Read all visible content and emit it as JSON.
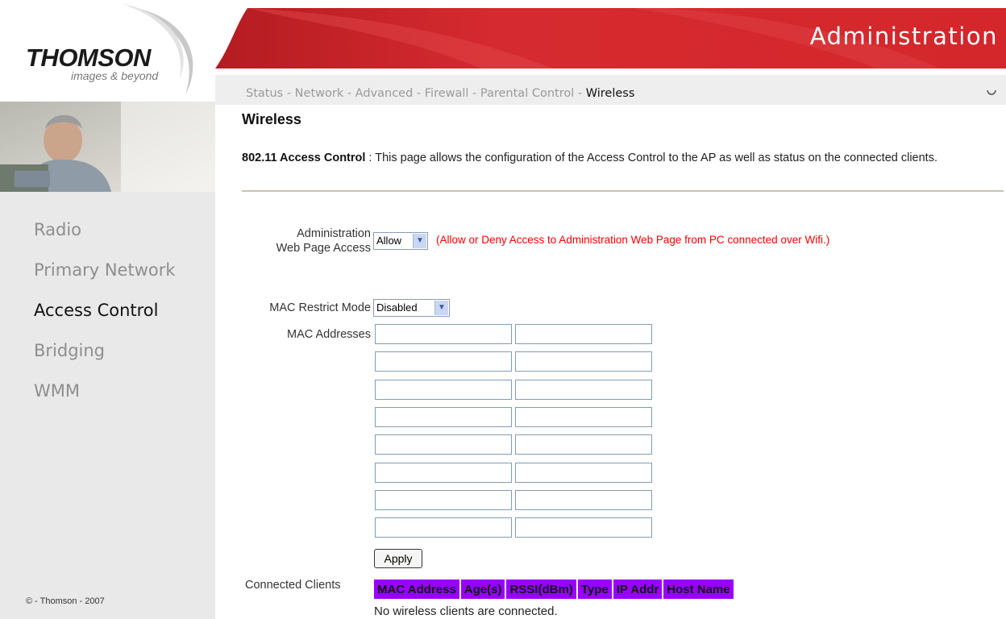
{
  "brand": {
    "name": "THOMSON",
    "tagline": "images & beyond",
    "copyright": "© - Thomson - 2007"
  },
  "header": {
    "title": "Administration"
  },
  "topnav": {
    "items": [
      {
        "label": "Status"
      },
      {
        "label": "Network"
      },
      {
        "label": "Advanced"
      },
      {
        "label": "Firewall"
      },
      {
        "label": "Parental Control"
      },
      {
        "label": "Wireless"
      }
    ],
    "separator": "-"
  },
  "sidebar": {
    "items": [
      {
        "label": "Radio"
      },
      {
        "label": "Primary Network"
      },
      {
        "label": "Access Control"
      },
      {
        "label": "Bridging"
      },
      {
        "label": "WMM"
      }
    ],
    "active": "Access Control"
  },
  "page": {
    "heading": "Wireless",
    "desc_title": "802.11 Access Control",
    "desc_text": " :  This page allows the configuration of the Access Control to the AP as well as status on the connected clients."
  },
  "form": {
    "admin_access": {
      "label_line1": "Administration",
      "label_line2": "Web Page Access",
      "value": "Allow",
      "hint": "(Allow or Deny Access to Administration Web Page from PC connected over Wifi.)"
    },
    "mac_restrict": {
      "label": "MAC Restrict Mode",
      "value": "Disabled"
    },
    "mac_addresses": {
      "label": "MAC Addresses",
      "values": [
        "",
        "",
        "",
        "",
        "",
        "",
        "",
        "",
        "",
        "",
        "",
        "",
        "",
        "",
        "",
        ""
      ]
    },
    "apply_label": "Apply"
  },
  "clients": {
    "label": "Connected Clients",
    "columns": [
      "MAC Address",
      "Age(s)",
      "RSSI(dBm)",
      "Type",
      "IP Addr",
      "Host Name"
    ],
    "empty_message": "No wireless clients are connected."
  },
  "colors": {
    "header_red": "#d0282c",
    "table_header": "#9900ff",
    "hint_red": "#ff0000"
  }
}
